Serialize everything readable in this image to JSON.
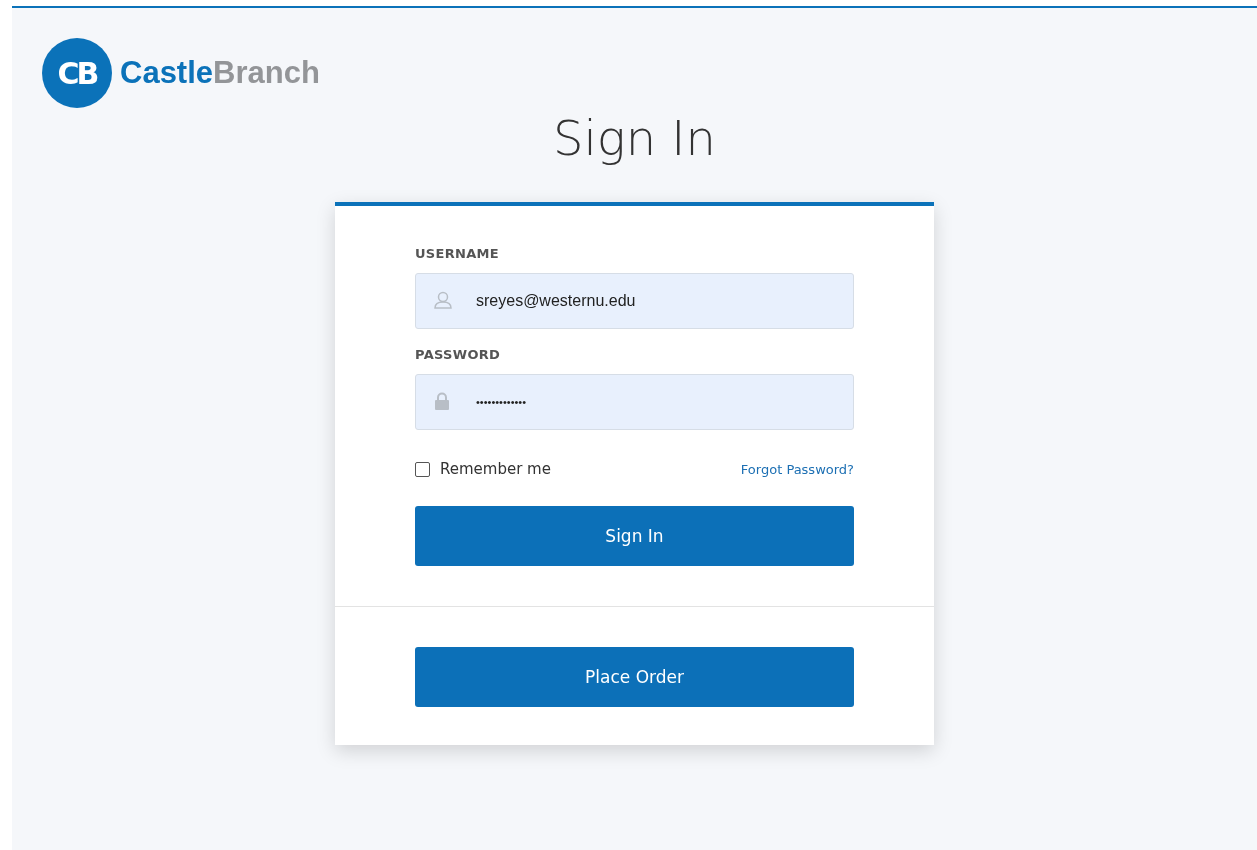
{
  "logo": {
    "monogram": "CB",
    "name_part_1": "Castle",
    "name_part_2": "Branch"
  },
  "title": "Sign In",
  "form": {
    "username": {
      "label": "USERNAME",
      "value": "sreyes@westernu.edu"
    },
    "password": {
      "label": "PASSWORD",
      "value": "•••••••••••••"
    },
    "remember": {
      "label": "Remember me",
      "checked": false
    },
    "forgot_link": "Forgot Password?",
    "submit": "Sign In"
  },
  "place_order": "Place Order"
}
